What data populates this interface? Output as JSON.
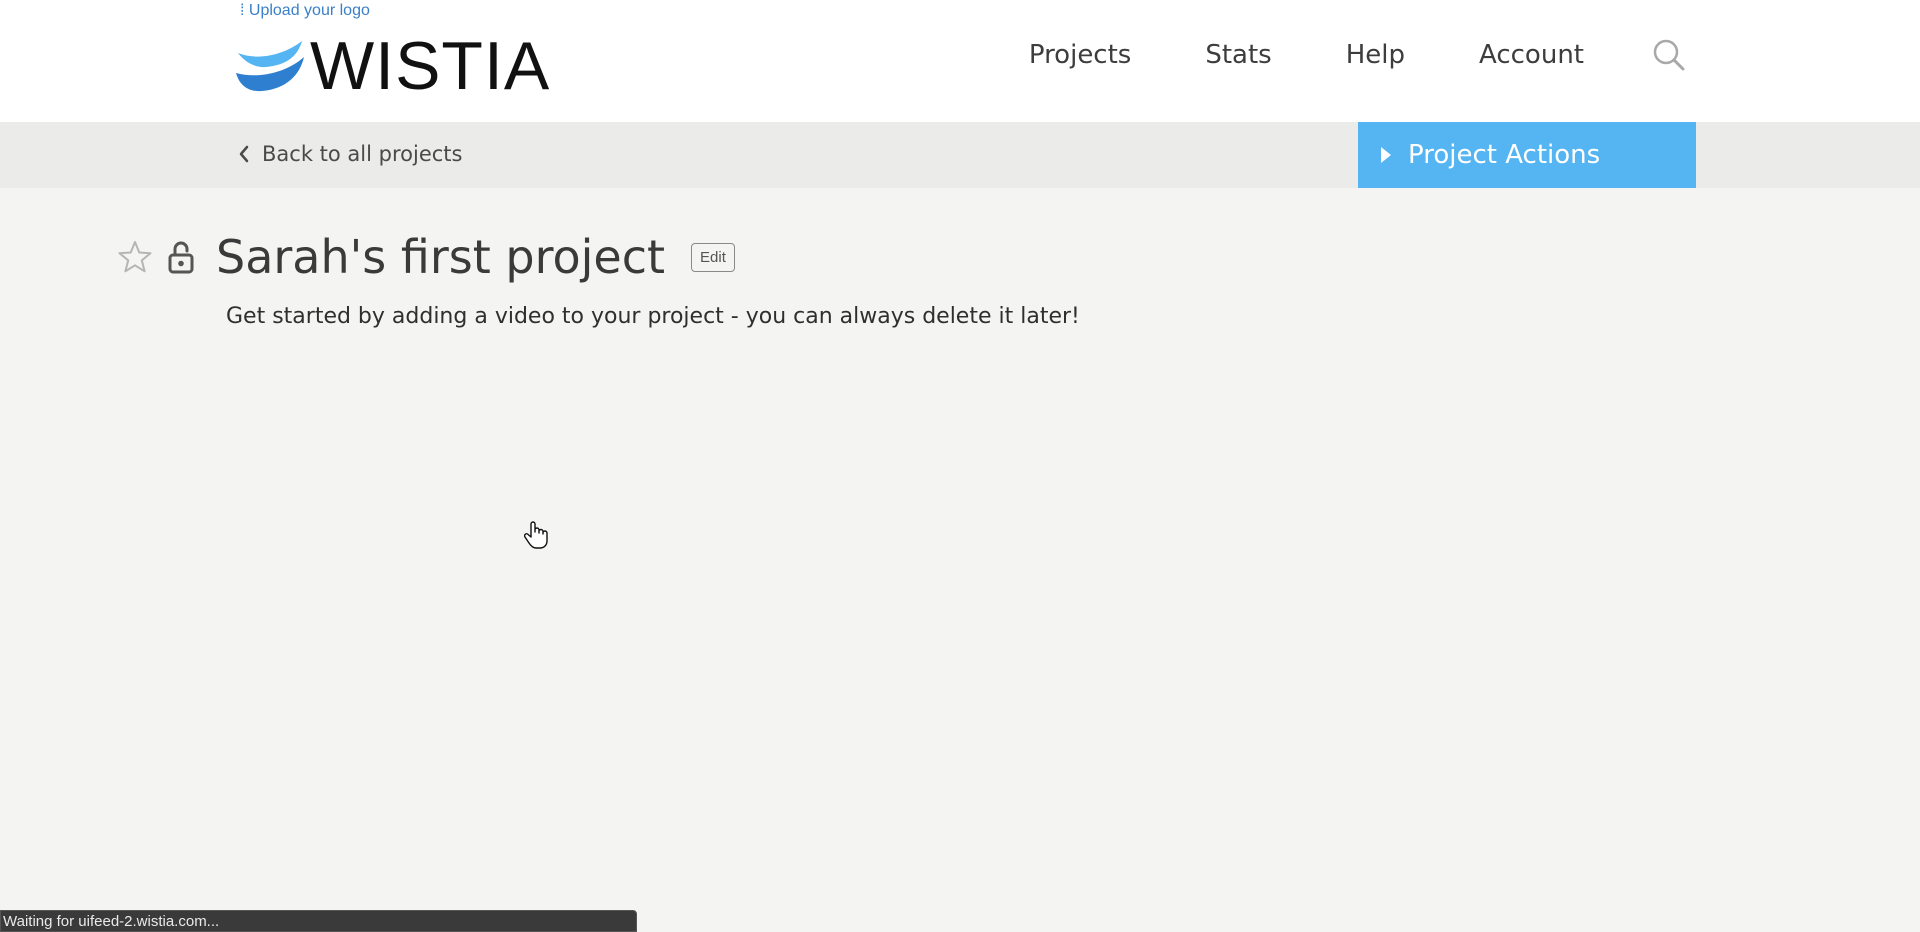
{
  "header": {
    "upload_logo": "⁞ Upload your logo",
    "logo_text": "WISTIA",
    "nav": {
      "projects": "Projects",
      "stats": "Stats",
      "help": "Help",
      "account": "Account"
    }
  },
  "subbar": {
    "back_label": "Back to all projects",
    "actions_label": "Project Actions"
  },
  "project": {
    "title": "Sarah's first project",
    "edit_label": "Edit",
    "description": "Get started by adding a video to your project - you can always delete it later!"
  },
  "status": {
    "text": "Waiting for uifeed-2.wistia.com..."
  },
  "colors": {
    "accent": "#54b5f2",
    "link": "#3a7fc8",
    "background": "#f4f4f2"
  }
}
